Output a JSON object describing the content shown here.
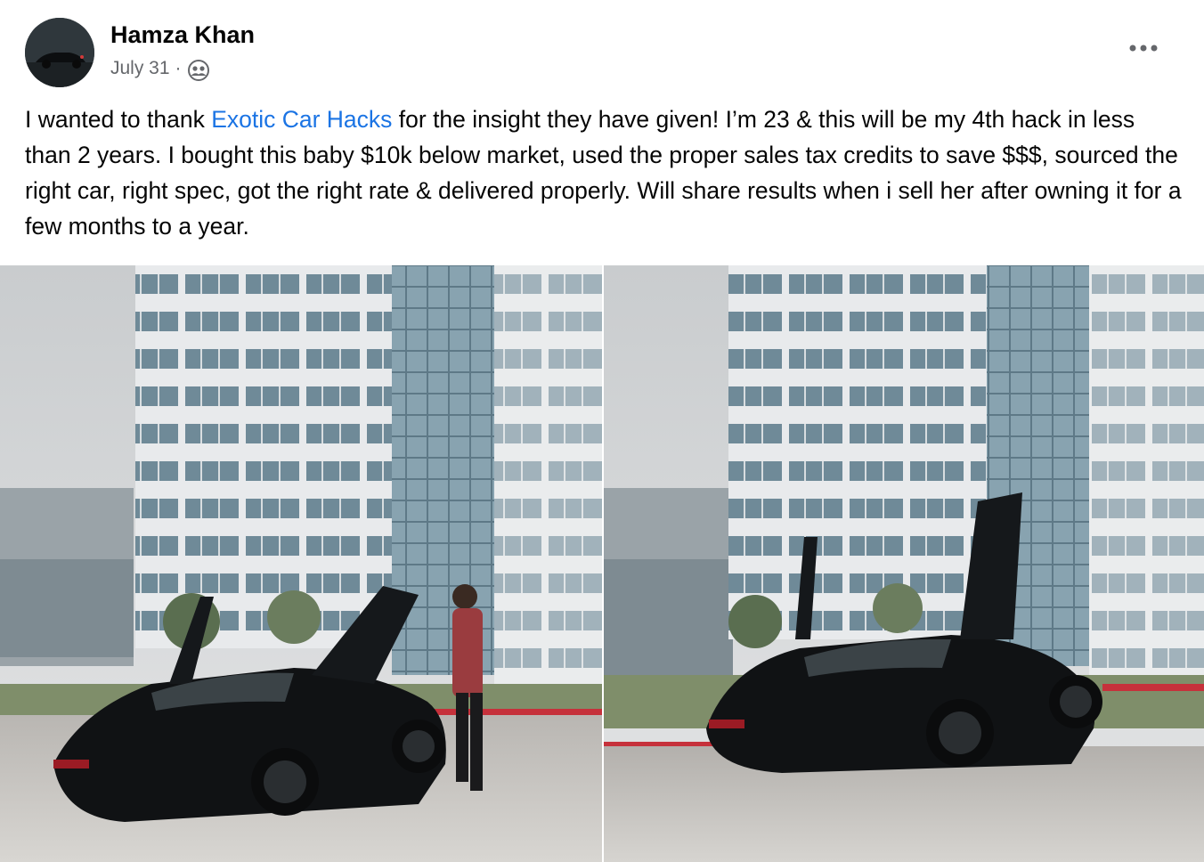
{
  "post": {
    "author": "Hamza Khan",
    "date": "July 31",
    "separator": "·",
    "audience_icon": "friends-icon",
    "more_icon": "more-options-icon",
    "text_before_mention": "I wanted to thank ",
    "mention": "Exotic Car Hacks",
    "text_after_mention": " for the insight they have given! I’m 23 & this will be my 4th hack in less than 2 years. I bought this baby $10k below market, used the proper sales tax credits to save $$$, sourced the right car, right spec, got the right rate & delivered properly. Will share results when i sell her after owning it for a few months to a year.",
    "photos": [
      {
        "name": "photo-1",
        "description_icon": "car-photo-with-person"
      },
      {
        "name": "photo-2",
        "description_icon": "car-photo"
      }
    ]
  },
  "colors": {
    "text": "#050505",
    "secondary": "#65676b",
    "link": "#1b74e4",
    "background": "#ffffff"
  }
}
